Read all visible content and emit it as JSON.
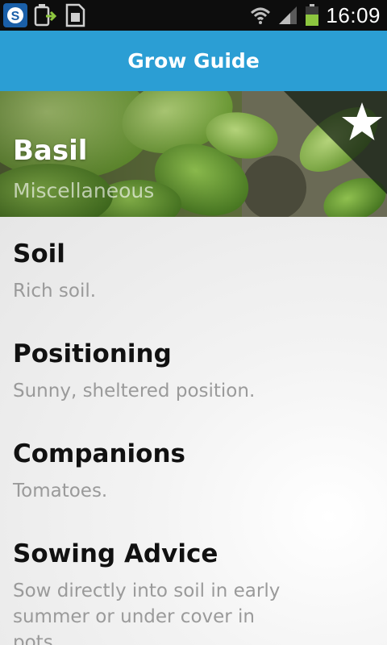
{
  "status_bar": {
    "time": "16:09",
    "left_icons": [
      "skype-icon",
      "download-icon",
      "sim-card-icon"
    ],
    "right_icons": [
      "wifi-icon",
      "signal-icon",
      "battery-icon"
    ],
    "battery_color": "#8dc63f"
  },
  "action_bar": {
    "title": "Grow Guide",
    "color": "#2b9ed4"
  },
  "plant": {
    "name": "Basil",
    "category": "Miscellaneous",
    "favorite_icon": "star-icon"
  },
  "sections": [
    {
      "title": "Soil",
      "body": "Rich soil."
    },
    {
      "title": "Positioning",
      "body": "Sunny, sheltered position."
    },
    {
      "title": "Companions",
      "body": "Tomatoes."
    },
    {
      "title": "Sowing Advice",
      "body": "Sow directly into soil in early summer or under cover in pots."
    }
  ]
}
